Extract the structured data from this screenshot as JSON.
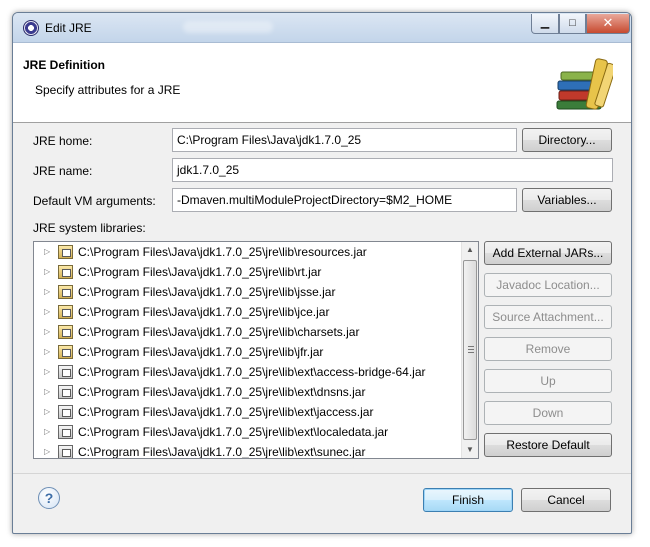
{
  "window": {
    "title": "Edit JRE",
    "controls": {
      "minimize": "▁",
      "maximize": "□",
      "close": "✕"
    }
  },
  "header": {
    "title": "JRE Definition",
    "description": "Specify attributes for a JRE",
    "icon": "library-books-icon"
  },
  "form": {
    "jre_home": {
      "label": "JRE home:",
      "value": "C:\\Program Files\\Java\\jdk1.7.0_25",
      "button": "Directory..."
    },
    "jre_name": {
      "label": "JRE name:",
      "value": "jdk1.7.0_25"
    },
    "vm_args": {
      "label": "Default VM arguments:",
      "value": "-Dmaven.multiModuleProjectDirectory=$M2_HOME",
      "button": "Variables..."
    }
  },
  "libraries": {
    "label": "JRE system libraries:",
    "items": [
      {
        "path": "C:\\Program Files\\Java\\jdk1.7.0_25\\jre\\lib\\resources.jar",
        "icon": "jar-icon"
      },
      {
        "path": "C:\\Program Files\\Java\\jdk1.7.0_25\\jre\\lib\\rt.jar",
        "icon": "jar-icon"
      },
      {
        "path": "C:\\Program Files\\Java\\jdk1.7.0_25\\jre\\lib\\jsse.jar",
        "icon": "jar-icon"
      },
      {
        "path": "C:\\Program Files\\Java\\jdk1.7.0_25\\jre\\lib\\jce.jar",
        "icon": "jar-icon"
      },
      {
        "path": "C:\\Program Files\\Java\\jdk1.7.0_25\\jre\\lib\\charsets.jar",
        "icon": "jar-icon"
      },
      {
        "path": "C:\\Program Files\\Java\\jdk1.7.0_25\\jre\\lib\\jfr.jar",
        "icon": "jar-icon"
      },
      {
        "path": "C:\\Program Files\\Java\\jdk1.7.0_25\\jre\\lib\\ext\\access-bridge-64.jar",
        "icon": "binary-jar-icon"
      },
      {
        "path": "C:\\Program Files\\Java\\jdk1.7.0_25\\jre\\lib\\ext\\dnsns.jar",
        "icon": "binary-jar-icon"
      },
      {
        "path": "C:\\Program Files\\Java\\jdk1.7.0_25\\jre\\lib\\ext\\jaccess.jar",
        "icon": "binary-jar-icon"
      },
      {
        "path": "C:\\Program Files\\Java\\jdk1.7.0_25\\jre\\lib\\ext\\localedata.jar",
        "icon": "binary-jar-icon"
      },
      {
        "path": "C:\\Program Files\\Java\\jdk1.7.0_25\\jre\\lib\\ext\\sunec.jar",
        "icon": "binary-jar-icon"
      }
    ],
    "buttons": {
      "add_external": "Add External JARs...",
      "javadoc": "Javadoc Location...",
      "source": "Source Attachment...",
      "remove": "Remove",
      "up": "Up",
      "down": "Down",
      "restore": "Restore Default"
    }
  },
  "footer": {
    "help": "?",
    "finish": "Finish",
    "cancel": "Cancel"
  }
}
